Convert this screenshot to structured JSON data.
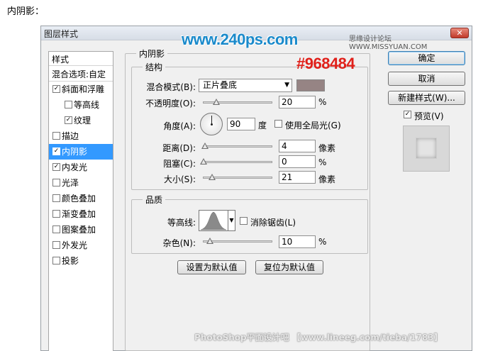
{
  "caption": "内阴影：",
  "dialog": {
    "title": "图层样式",
    "close": "✕"
  },
  "watermarks": {
    "site": "www.240ps.com",
    "forum": "思缘设计论坛 WWW.MISSYUAN.COM",
    "hex": "#968484",
    "bottom": "PhotoShop平面设计吧 【www.lineeg.com/tieba/1783】"
  },
  "style_list": {
    "header": "样式",
    "blending_options": "混合选项:自定",
    "items": [
      {
        "label": "斜面和浮雕",
        "checked": true,
        "indent": false,
        "selected": false
      },
      {
        "label": "等高线",
        "checked": false,
        "indent": true,
        "selected": false
      },
      {
        "label": "纹理",
        "checked": true,
        "indent": true,
        "selected": false
      },
      {
        "label": "描边",
        "checked": false,
        "indent": false,
        "selected": false
      },
      {
        "label": "内阴影",
        "checked": true,
        "indent": false,
        "selected": true
      },
      {
        "label": "内发光",
        "checked": true,
        "indent": false,
        "selected": false
      },
      {
        "label": "光泽",
        "checked": false,
        "indent": false,
        "selected": false
      },
      {
        "label": "颜色叠加",
        "checked": false,
        "indent": false,
        "selected": false
      },
      {
        "label": "渐变叠加",
        "checked": false,
        "indent": false,
        "selected": false
      },
      {
        "label": "图案叠加",
        "checked": false,
        "indent": false,
        "selected": false
      },
      {
        "label": "外发光",
        "checked": false,
        "indent": false,
        "selected": false
      },
      {
        "label": "投影",
        "checked": false,
        "indent": false,
        "selected": false
      }
    ]
  },
  "inner_shadow": {
    "group_title": "内阴影",
    "structure": {
      "title": "结构",
      "blend_mode_label": "混合模式(B):",
      "blend_mode_value": "正片叠底",
      "swatch_color": "#968484",
      "opacity_label": "不透明度(O):",
      "opacity_value": "20",
      "opacity_unit": "%",
      "angle_label": "角度(A):",
      "angle_value": "90",
      "angle_unit": "度",
      "global_light_label": "使用全局光(G)",
      "global_light_checked": false,
      "distance_label": "距离(D):",
      "distance_value": "4",
      "distance_unit": "像素",
      "choke_label": "阻塞(C):",
      "choke_value": "0",
      "choke_unit": "%",
      "size_label": "大小(S):",
      "size_value": "21",
      "size_unit": "像素"
    },
    "quality": {
      "title": "品质",
      "contour_label": "等高线:",
      "antialias_label": "消除锯齿(L)",
      "antialias_checked": false,
      "noise_label": "杂色(N):",
      "noise_value": "10",
      "noise_unit": "%"
    },
    "make_default": "设置为默认值",
    "reset_default": "复位为默认值"
  },
  "right": {
    "ok": "确定",
    "cancel": "取消",
    "new_style": "新建样式(W)...",
    "preview_label": "预览(V)",
    "preview_checked": true
  }
}
